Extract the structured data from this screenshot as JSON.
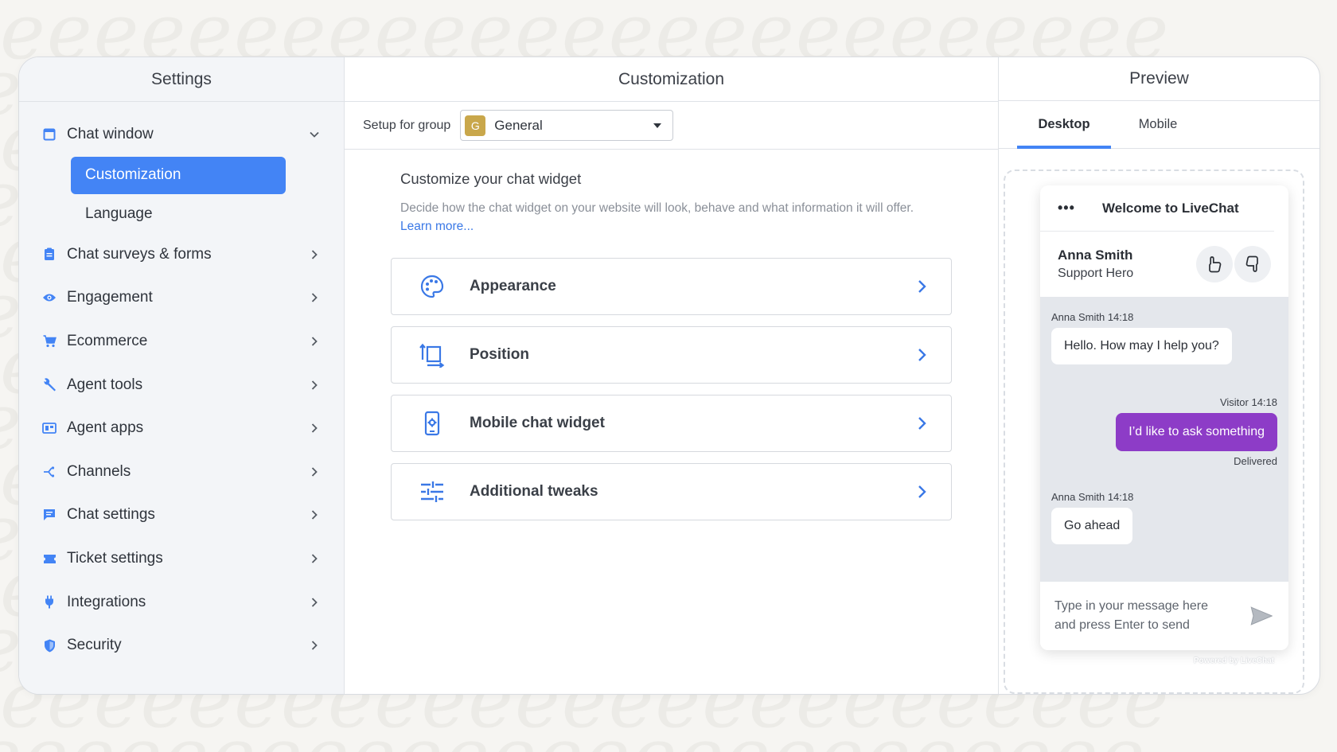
{
  "left_panel": {
    "title": "Settings",
    "items": [
      {
        "label": "Chat window",
        "icon": "window-icon",
        "expanded": true
      },
      {
        "label": "Chat surveys & forms",
        "icon": "clipboard-icon"
      },
      {
        "label": "Engagement",
        "icon": "eye-icon"
      },
      {
        "label": "Ecommerce",
        "icon": "cart-icon"
      },
      {
        "label": "Agent tools",
        "icon": "wrench-icon"
      },
      {
        "label": "Agent apps",
        "icon": "apps-icon"
      },
      {
        "label": "Channels",
        "icon": "channels-icon"
      },
      {
        "label": "Chat settings",
        "icon": "chat-icon"
      },
      {
        "label": "Ticket settings",
        "icon": "ticket-icon"
      },
      {
        "label": "Integrations",
        "icon": "plug-icon"
      },
      {
        "label": "Security",
        "icon": "shield-icon"
      }
    ],
    "sub_items": [
      {
        "label": "Customization",
        "active": true
      },
      {
        "label": "Language",
        "active": false
      }
    ]
  },
  "center_panel": {
    "title": "Customization",
    "group_label": "Setup for group",
    "group_badge": "G",
    "group_value": "General",
    "intro_title": "Customize your chat widget",
    "intro_desc": "Decide how the chat widget on your website will look, behave and what information it will offer.",
    "intro_link": "Learn more...",
    "cards": [
      {
        "label": "Appearance",
        "icon": "palette-icon"
      },
      {
        "label": "Position",
        "icon": "position-icon"
      },
      {
        "label": "Mobile chat widget",
        "icon": "mobile-settings-icon"
      },
      {
        "label": "Additional tweaks",
        "icon": "sliders-icon"
      }
    ]
  },
  "right_panel": {
    "title": "Preview",
    "tabs": [
      {
        "label": "Desktop",
        "active": true
      },
      {
        "label": "Mobile",
        "active": false
      }
    ],
    "widget": {
      "menu": "•••",
      "title": "Welcome to LiveChat",
      "agent_name": "Anna Smith",
      "agent_role": "Support Hero",
      "messages": [
        {
          "meta": "Anna Smith 14:18",
          "text": "Hello. How may I help you?"
        },
        {
          "meta": "Visitor 14:18",
          "text": "I’d like to ask something",
          "status": "Delivered"
        },
        {
          "meta": "Anna Smith 14:18",
          "text": "Go ahead"
        }
      ],
      "input_placeholder_line1": "Type in your message here",
      "input_placeholder_line2": "and press Enter to send",
      "powered_by": "Powered by LiveChat"
    }
  },
  "colors": {
    "accent": "#4384f5",
    "visitor_bubble": "#8d3cc7",
    "group_badge": "#c9a74b",
    "chat_background": "#e4e7ec"
  }
}
